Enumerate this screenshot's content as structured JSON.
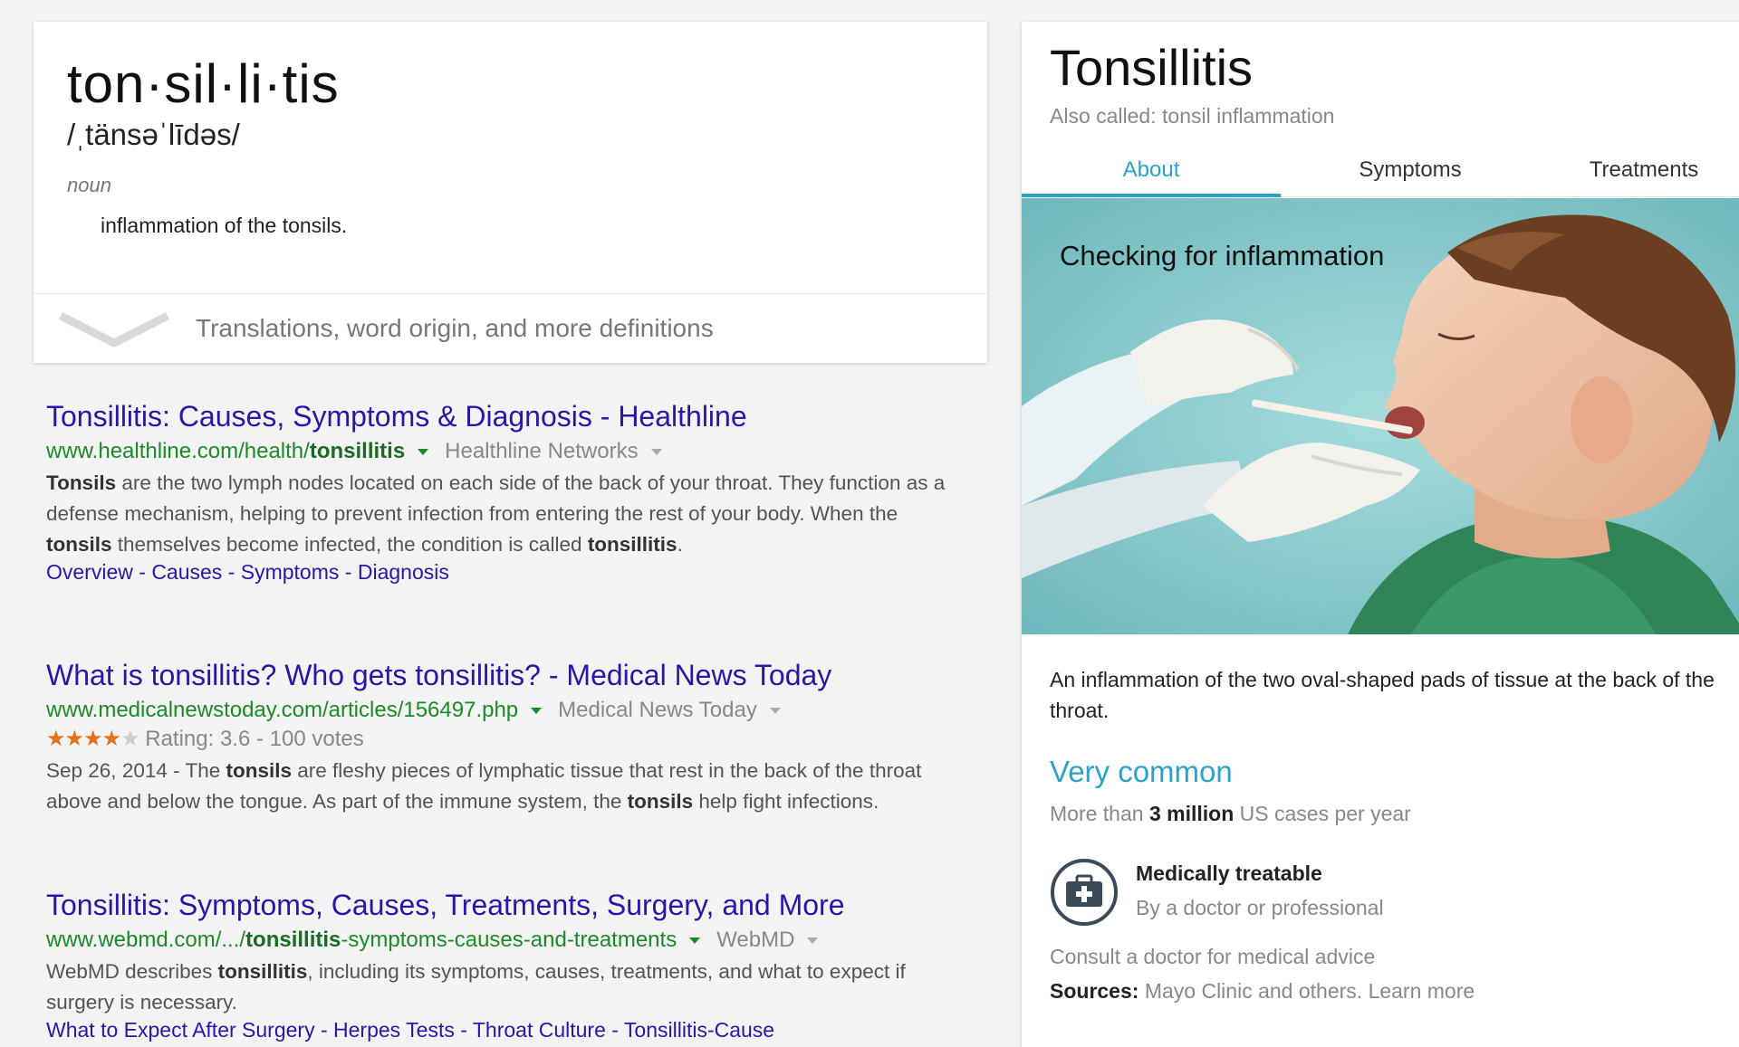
{
  "dictionary": {
    "word": "ton·sil·li·tis",
    "phonetic": "/ˌtänsəˈlīdəs/",
    "part_of_speech": "noun",
    "definition": "inflammation of the tonsils.",
    "more_label": "Translations, word origin, and more definitions"
  },
  "results": [
    {
      "title": "Tonsillitis: Causes, Symptoms & Diagnosis - Healthline",
      "url_prefix": "www.healthline.com/health/",
      "url_bold": "tonsillitis",
      "url_suffix": "",
      "source": "Healthline Networks",
      "snippet": [
        {
          "b": "Tonsils"
        },
        {
          "t": " are the two lymph nodes located on each side of the back of your throat. They function as a defense mechanism, helping to prevent infection from entering the rest of your body. When the "
        },
        {
          "b": "tonsils"
        },
        {
          "t": " themselves become infected, the condition is called "
        },
        {
          "b": "tonsillitis"
        },
        {
          "t": "."
        }
      ],
      "links": [
        "Overview",
        "Causes",
        "Symptoms",
        "Diagnosis"
      ]
    },
    {
      "title": "What is tonsillitis? Who gets tonsillitis? - Medical News Today",
      "url_prefix": "www.medicalnewstoday.com/articles/156497.php",
      "url_bold": "",
      "url_suffix": "",
      "source": "Medical News Today",
      "rating": {
        "stars": 3.6,
        "text": "Rating: 3.6 - 100 votes"
      },
      "snippet": [
        {
          "t": "Sep 26, 2014 - The "
        },
        {
          "b": "tonsils"
        },
        {
          "t": " are fleshy pieces of lymphatic tissue that rest in the back of the throat above and below the tongue. As part of the immune system, the "
        },
        {
          "b": "tonsils"
        },
        {
          "t": " help fight infections."
        }
      ],
      "links": []
    },
    {
      "title": "Tonsillitis: Symptoms, Causes, Treatments, Surgery, and More",
      "url_prefix": "www.webmd.com/.../",
      "url_bold": "tonsillitis",
      "url_suffix": "-symptoms-causes-and-treatments",
      "source": "WebMD",
      "snippet": [
        {
          "t": "WebMD describes "
        },
        {
          "b": "tonsillitis"
        },
        {
          "t": ", including its symptoms, causes, treatments, and what to expect if surgery is necessary."
        }
      ],
      "links": [
        "What to Expect After Surgery",
        "Herpes Tests",
        "Throat Culture",
        "Tonsillitis-Cause"
      ]
    }
  ],
  "panel": {
    "title": "Tonsillitis",
    "alias": "Also called: tonsil inflammation",
    "tabs": [
      "About",
      "Symptoms",
      "Treatments"
    ],
    "active_tab": 0,
    "image_caption": "Checking for inflammation",
    "description": "An inflammation of the two oval-shaped pads of tissue at the back of the throat.",
    "frequency": "Very common",
    "frequency_note_prefix": "More than ",
    "frequency_note_bold": "3 million",
    "frequency_note_suffix": " US cases per year",
    "treatable_title": "Medically treatable",
    "treatable_sub": "By a doctor or professional",
    "consult": "Consult a doctor for medical advice",
    "sources_label": "Sources:",
    "sources_text": " Mayo Clinic and others. ",
    "learn_more": "Learn more",
    "icon": "medical-kit-icon",
    "accent_color": "#2aa3c6"
  }
}
